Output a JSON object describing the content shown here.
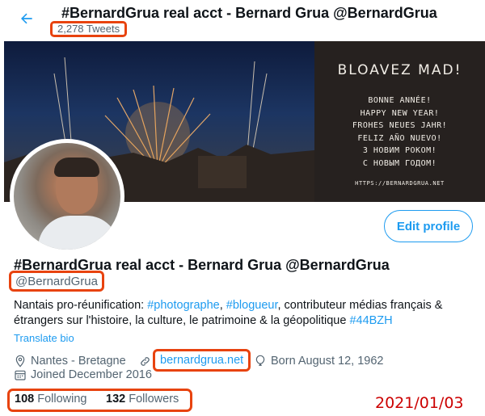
{
  "header": {
    "title": "#BernardGrua real acct - Bernard Grua @BernardGrua",
    "tweet_count": "2,278 Tweets",
    "back_icon": "arrow-left-icon"
  },
  "banner": {
    "heading": "BLOAVEZ MAD!",
    "lines": [
      "BONNE ANNÉE!",
      "HAPPY NEW YEAR!",
      "FROHES NEUES JAHR!",
      "FELIZ AÑO NUEVO!",
      "З НОВИМ РОКОМ!",
      "С НОВЫМ ГОДОМ!"
    ],
    "url": "HTTPS://BERNARDGRUA.NET"
  },
  "profile": {
    "edit_button": "Edit profile",
    "display_name": "#BernardGrua real acct - Bernard Grua @BernardGrua",
    "handle": "@BernardGrua",
    "bio": {
      "p1": "Nantais pro-réunification: ",
      "tag1": "#photographe",
      "p2": ", ",
      "tag2": "#blogueur",
      "p3": ", contributeur médias français & étrangers sur l'histoire, la culture, le patrimoine & la géopolitique ",
      "tag3": "#44BZH"
    },
    "translate": "Translate bio",
    "location": "Nantes - Bretagne",
    "website": "bernardgrua.net",
    "birthday": "Born August 12, 1962",
    "joined": "Joined December 2016",
    "following_count": "108",
    "following_label": "Following",
    "followers_count": "132",
    "followers_label": "Followers"
  },
  "annotation": {
    "date": "2021/01/03"
  },
  "colors": {
    "accent": "#1d9bf0",
    "highlight_box": "#e8430f",
    "date_stamp": "#cc0000"
  }
}
